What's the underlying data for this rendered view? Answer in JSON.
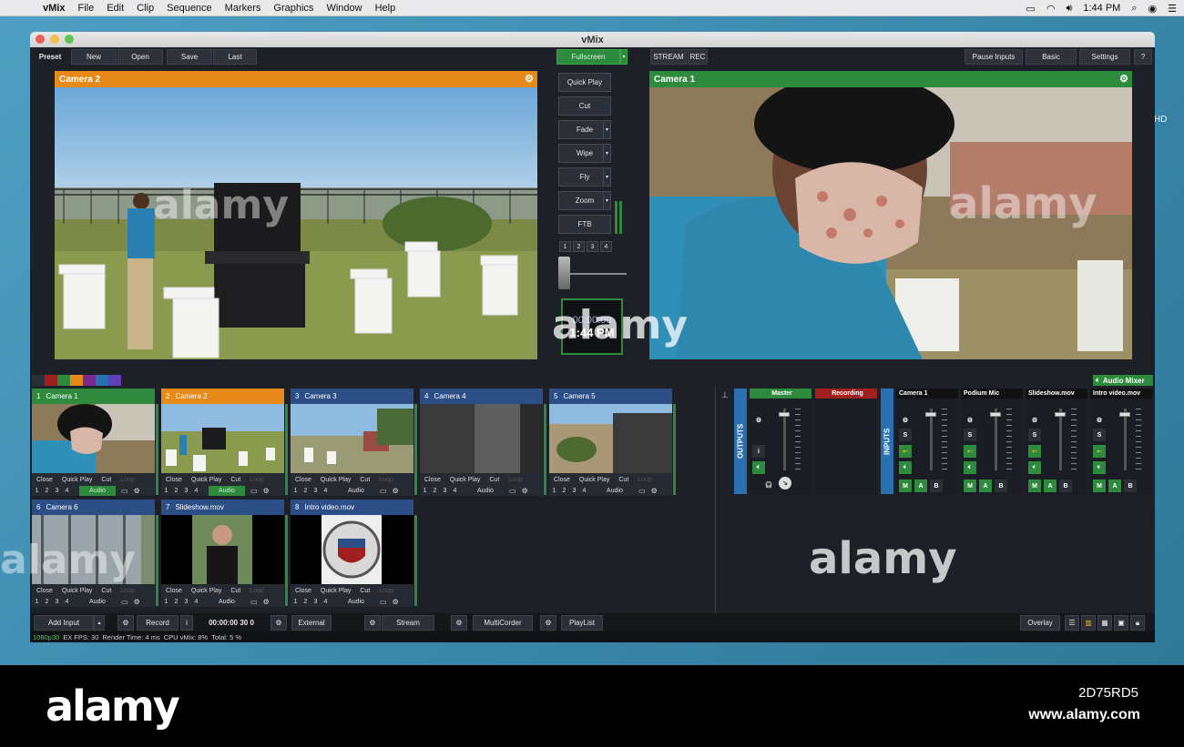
{
  "menubar": {
    "app": "vMix",
    "items": [
      "File",
      "Edit",
      "Clip",
      "Sequence",
      "Markers",
      "Graphics",
      "Window",
      "Help"
    ],
    "time": "1:44 PM"
  },
  "desktop": {
    "hd_label": "HD"
  },
  "window": {
    "title": "vMix",
    "toolbar": {
      "preset": "Preset",
      "new": "New",
      "open": "Open",
      "save": "Save",
      "last": "Last",
      "fullscreen": "Fullscreen",
      "stream": "STREAM",
      "rec": "REC",
      "pause_inputs": "Pause Inputs",
      "basic": "Basic",
      "settings": "Settings",
      "help": "?"
    },
    "preview": {
      "title": "Camera 2"
    },
    "output": {
      "title": "Camera 1"
    },
    "transitions": {
      "quick_play": "Quick Play",
      "cut": "Cut",
      "fade": "Fade",
      "wipe": "Wipe",
      "fly": "Fly",
      "zoom": "Zoom",
      "ftb": "FTB",
      "numbers": [
        "1",
        "2",
        "3",
        "4"
      ]
    },
    "clock": {
      "timecode": "00:00:00",
      "time": "1:44 PM"
    },
    "palette_colors": [
      "#2b2f37",
      "#a01f1f",
      "#2e8b3e",
      "#e68a1a",
      "#7a2b8e",
      "#2a6fb0",
      "#5e3fb5"
    ],
    "audio_mixer_label": "Audio Mixer",
    "inputs": [
      {
        "num": "1",
        "name": "Camera 1",
        "header_color": "#2e8b3e",
        "audio_active": true,
        "thumb": "camera1"
      },
      {
        "num": "2",
        "name": "Camera 2",
        "header_color": "#e68a1a",
        "audio_active": true,
        "thumb": "camera2"
      },
      {
        "num": "3",
        "name": "Camera 3",
        "header_color": "#2c4e86",
        "audio_active": false,
        "thumb": "camera3"
      },
      {
        "num": "4",
        "name": "Camera 4",
        "header_color": "#2c4e86",
        "audio_active": false,
        "thumb": "camera4"
      },
      {
        "num": "5",
        "name": "Camera 5",
        "header_color": "#2c4e86",
        "audio_active": false,
        "thumb": "camera5"
      },
      {
        "num": "6",
        "name": "Camera 6",
        "header_color": "#2c4e86",
        "audio_active": false,
        "thumb": "camera6"
      },
      {
        "num": "7",
        "name": "Slideshow.mov",
        "header_color": "#2c4e86",
        "audio_active": false,
        "thumb": "slideshow"
      },
      {
        "num": "8",
        "name": "Intro video.mov",
        "header_color": "#2c4e86",
        "audio_active": false,
        "thumb": "intro"
      }
    ],
    "tile_labels": {
      "close": "Close",
      "quick_play": "Quick Play",
      "cut": "Cut",
      "loop": "Loop",
      "audio": "Audio",
      "nums": [
        "1",
        "2",
        "3",
        "4"
      ]
    },
    "mixer": {
      "outputs_label": "OUTPUTS",
      "inputs_label": "INPUTS",
      "master": "Master",
      "recording": "Recording",
      "strips": [
        "Camera 1",
        "Podium Mic",
        "Slideshow.mov",
        "Intro video.mov"
      ],
      "solo": "S",
      "bus": [
        "M",
        "A",
        "B"
      ],
      "info": "i"
    },
    "bottom": {
      "add_input": "Add Input",
      "record": "Record",
      "info": "i",
      "rec_time": "00:00:00 30 0",
      "external": "External",
      "stream": "Stream",
      "multicorder": "MultiCorder",
      "playlist": "PlayList",
      "overlay": "Overlay"
    },
    "status": {
      "format": "1080p30",
      "fps": "EX  FPS:  30",
      "render": "Render Time:   4 ms",
      "cpu": "CPU vMix:  8%",
      "total": "Total:  5 %"
    }
  },
  "watermark": {
    "text": "alamy",
    "footer_logo": "alamy",
    "code": "2D75RD5",
    "url": "www.alamy.com"
  }
}
